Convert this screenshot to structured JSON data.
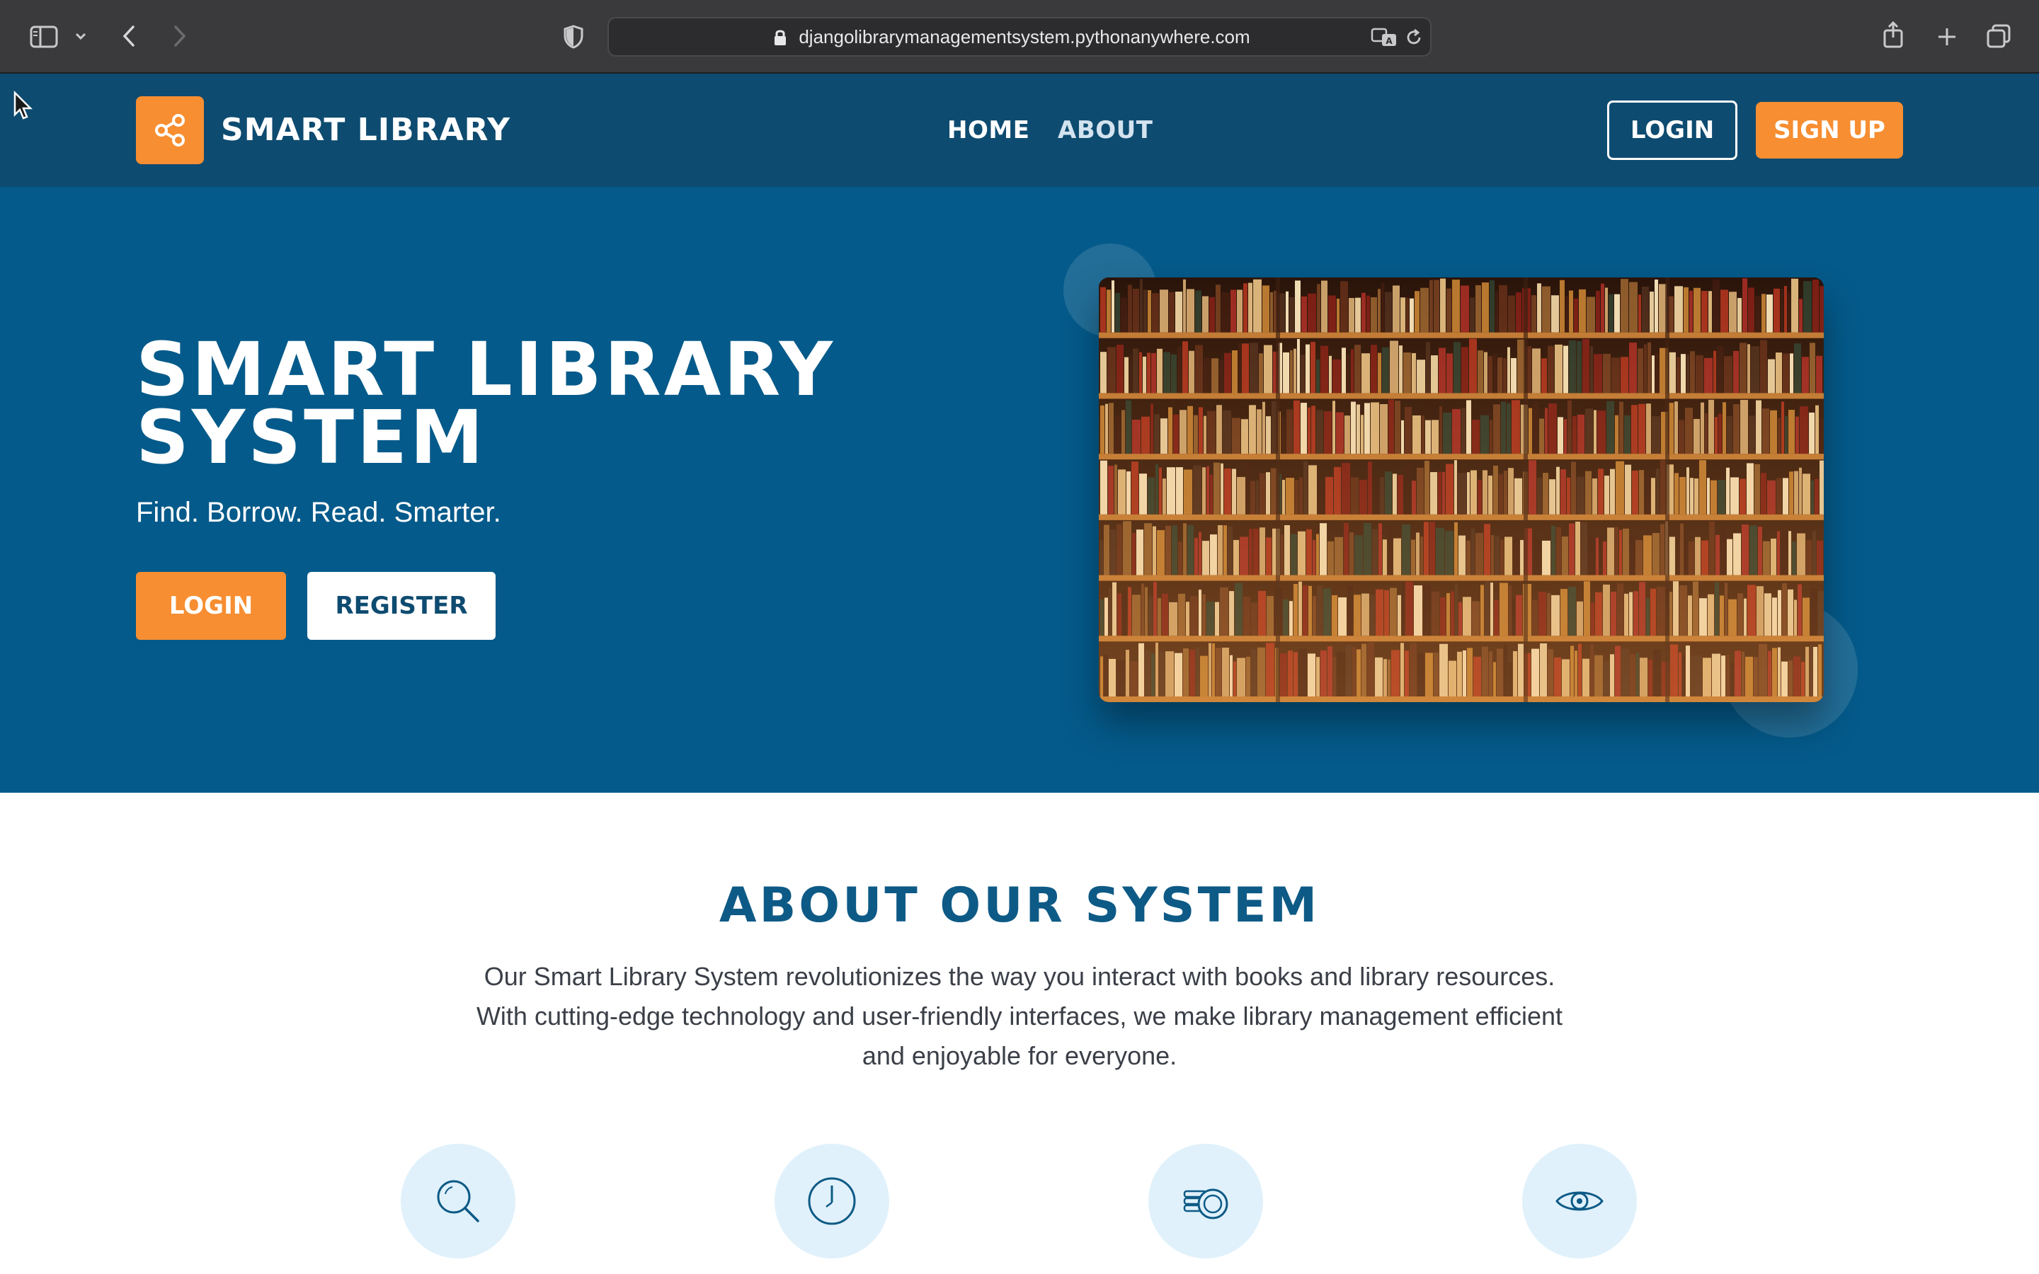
{
  "browser": {
    "url": "djangolibrarymanagementsystem.pythonanywhere.com",
    "icons": [
      "sidebar-icon",
      "chevron-down-icon",
      "back-icon",
      "forward-icon",
      "shield-icon",
      "lock-icon",
      "translate-icon",
      "reload-icon",
      "share-icon",
      "plus-icon",
      "tabs-icon"
    ]
  },
  "nav": {
    "brand": "SMART LIBRARY",
    "brand_icon": "share-icon",
    "links": [
      {
        "label": "HOME"
      },
      {
        "label": "ABOUT"
      }
    ],
    "login_label": "LOGIN",
    "signup_label": "SIGN UP"
  },
  "hero": {
    "title_line1": "SMART LIBRARY",
    "title_line2": "SYSTEM",
    "subtitle": "Find. Borrow. Read. Smarter.",
    "login_label": "LOGIN",
    "register_label": "REGISTER",
    "image": "bookshelf-image"
  },
  "about": {
    "title": "ABOUT OUR SYSTEM",
    "text_line1": "Our Smart Library System revolutionizes the way you interact with books and library resources.",
    "text_line2": "With cutting-edge technology and user-friendly interfaces, we make library management efficient",
    "text_line3": "and enjoyable for everyone.",
    "features": [
      {
        "icon": "search-icon"
      },
      {
        "icon": "clock-icon"
      },
      {
        "icon": "coins-icon"
      },
      {
        "icon": "eye-icon"
      }
    ]
  },
  "colors": {
    "nav_bg": "#0e4b70",
    "hero_bg": "#045a8a",
    "accent": "#f78e31",
    "title_blue": "#0e5a86",
    "feature_bg": "#e0f1fb"
  }
}
